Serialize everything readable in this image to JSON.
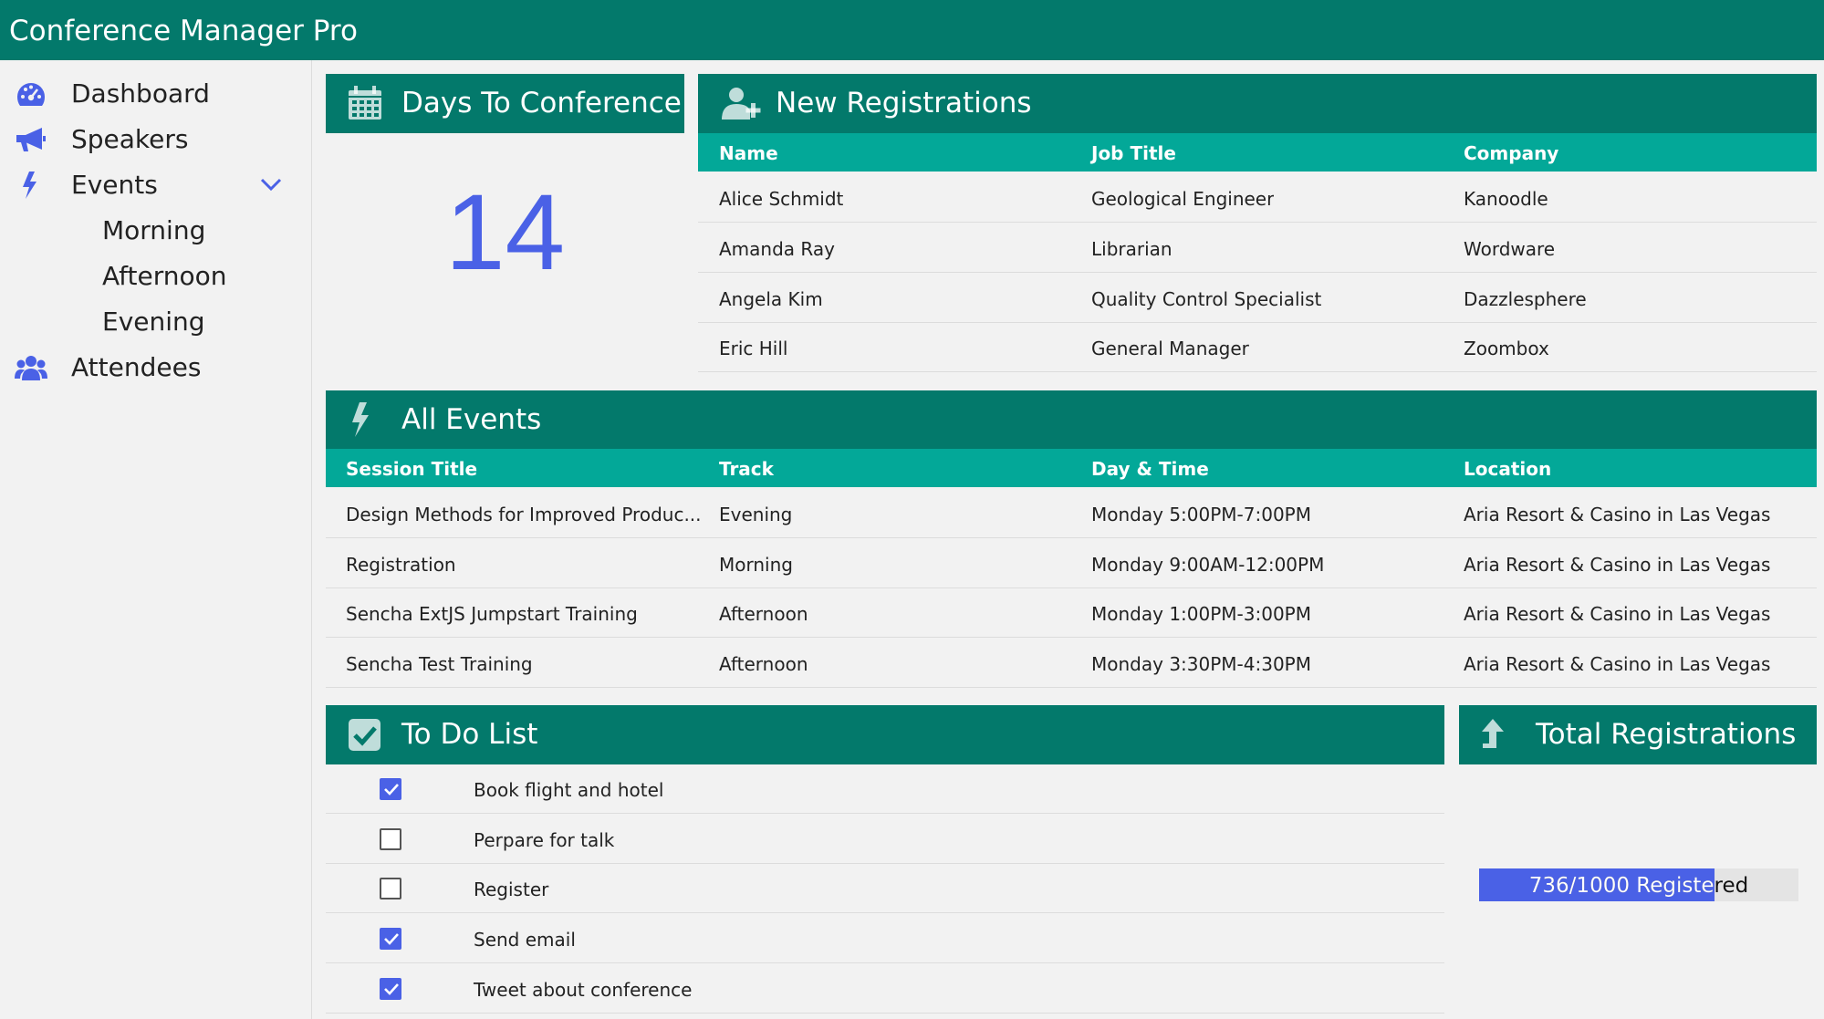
{
  "app": {
    "title": "Conference Manager Pro"
  },
  "colors": {
    "primary": "#03796b",
    "header_row": "#03a898",
    "accent": "#4a61e6"
  },
  "sidebar": {
    "items": [
      {
        "label": "Dashboard",
        "icon": "dashboard-icon"
      },
      {
        "label": "Speakers",
        "icon": "megaphone-icon"
      },
      {
        "label": "Events",
        "icon": "bolt-icon",
        "expanded": true,
        "children": [
          {
            "label": "Morning"
          },
          {
            "label": "Afternoon"
          },
          {
            "label": "Evening"
          }
        ]
      },
      {
        "label": "Attendees",
        "icon": "users-icon"
      }
    ]
  },
  "days_to_conference": {
    "title": "Days To Conference",
    "icon": "calendar-icon",
    "value": "14"
  },
  "new_registrations": {
    "title": "New Registrations",
    "icon": "user-plus-icon",
    "columns": [
      "Name",
      "Job Title",
      "Company"
    ],
    "rows": [
      [
        "Alice Schmidt",
        "Geological Engineer",
        "Kanoodle"
      ],
      [
        "Amanda Ray",
        "Librarian",
        "Wordware"
      ],
      [
        "Angela Kim",
        "Quality Control Specialist",
        "Dazzlesphere"
      ],
      [
        "Eric Hill",
        "General Manager",
        "Zoombox"
      ]
    ]
  },
  "all_events": {
    "title": "All Events",
    "icon": "bolt-icon",
    "columns": [
      "Session Title",
      "Track",
      "Day & Time",
      "Location"
    ],
    "rows": [
      [
        "Design Methods for Improved Produc...",
        "Evening",
        "Monday 5:00PM-7:00PM",
        "Aria Resort & Casino in Las Vegas"
      ],
      [
        "Registration",
        "Morning",
        "Monday 9:00AM-12:00PM",
        "Aria Resort & Casino in Las Vegas"
      ],
      [
        "Sencha ExtJS Jumpstart Training",
        "Afternoon",
        "Monday 1:00PM-3:00PM",
        "Aria Resort & Casino in Las Vegas"
      ],
      [
        "Sencha Test Training",
        "Afternoon",
        "Monday 3:30PM-4:30PM",
        "Aria Resort & Casino in Las Vegas"
      ]
    ]
  },
  "todo": {
    "title": "To Do List",
    "icon": "check-square-icon",
    "items": [
      {
        "label": "Book flight and hotel",
        "checked": true
      },
      {
        "label": "Perpare for talk",
        "checked": false
      },
      {
        "label": "Register",
        "checked": false
      },
      {
        "label": "Send email",
        "checked": true
      },
      {
        "label": "Tweet about conference",
        "checked": true
      }
    ]
  },
  "total_registrations": {
    "title": "Total Registrations",
    "icon": "arrow-up-icon",
    "label": "736/1000 Registered",
    "registered": 736,
    "capacity": 1000
  }
}
